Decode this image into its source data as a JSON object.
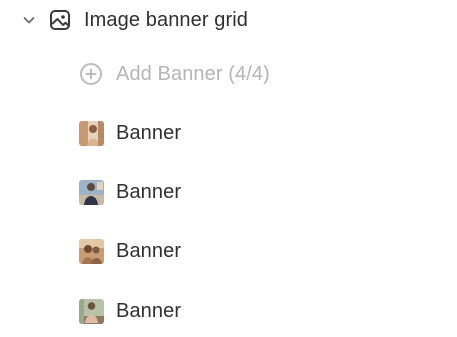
{
  "section": {
    "label": "Image banner grid",
    "chevron_icon": "chevron-down-icon",
    "section_icon": "image-icon"
  },
  "add_banner": {
    "label": "Add Banner (4/4)",
    "icon": "plus-circle-icon",
    "disabled": true
  },
  "banners": [
    {
      "label": "Banner",
      "thumb_colors": [
        "#c9a07a",
        "#e8d6c0",
        "#7d5a3c"
      ]
    },
    {
      "label": "Banner",
      "thumb_colors": [
        "#8ba3b8",
        "#3b3f52",
        "#d7c7b0"
      ]
    },
    {
      "label": "Banner",
      "thumb_colors": [
        "#b88962",
        "#6e4b34",
        "#e2c9a6"
      ]
    },
    {
      "label": "Banner",
      "thumb_colors": [
        "#a9b7a0",
        "#d9b9a0",
        "#7a6a58"
      ]
    }
  ],
  "colors": {
    "text": "#303030",
    "muted": "#b5b5b5",
    "icon": "#4a4a4a"
  }
}
